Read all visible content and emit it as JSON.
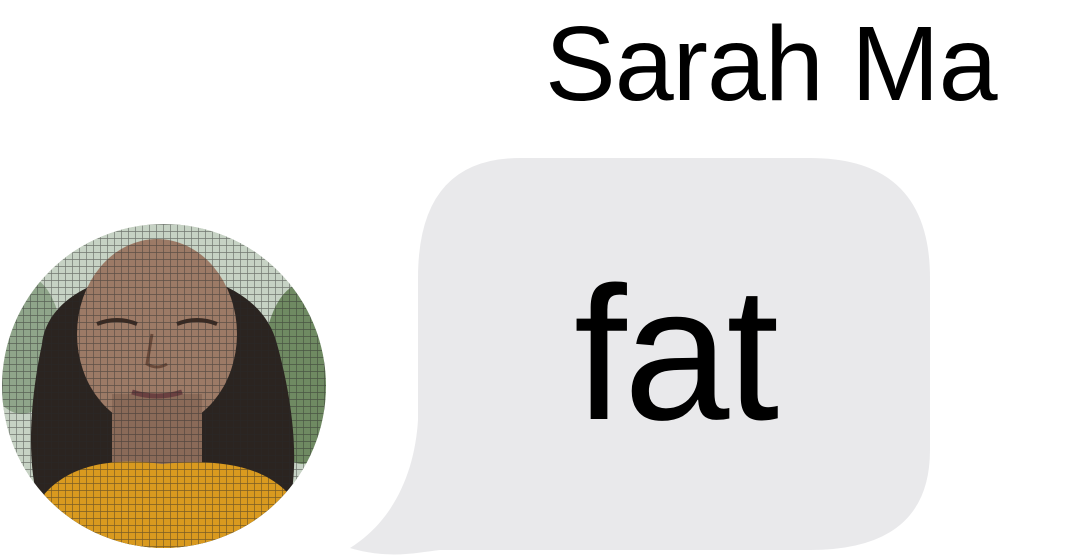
{
  "conversation": {
    "sender_name": "Sarah Ma",
    "message_text": "fat",
    "bubble_color": "#e9e9eb",
    "text_color": "#000000"
  },
  "avatar": {
    "icon": "contact-photo"
  }
}
